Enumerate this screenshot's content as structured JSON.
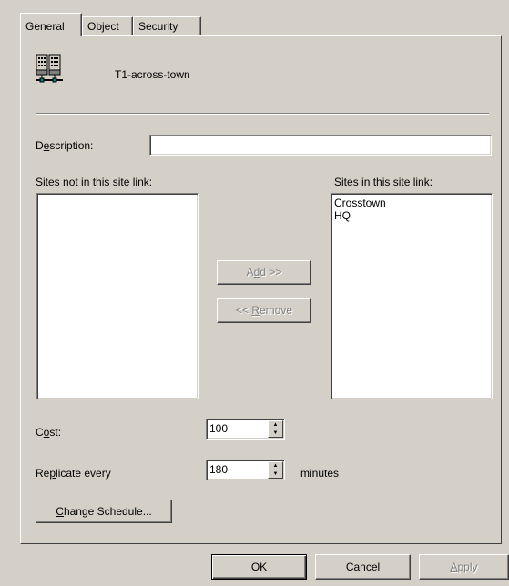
{
  "tabs": [
    {
      "label": "General",
      "active": true
    },
    {
      "label": "Object",
      "active": false
    },
    {
      "label": "Security",
      "active": false
    }
  ],
  "object_icon": "server-icon",
  "object_name": "T1-across-town",
  "description": {
    "label_pre": "D",
    "label_u": "e",
    "label_post": "scription:",
    "value": ""
  },
  "sites_not_in": {
    "label_pre": "Sites ",
    "label_u": "n",
    "label_post": "ot in this site link:",
    "items": []
  },
  "sites_in": {
    "label_pre": "",
    "label_u": "S",
    "label_post": "ites in this site link:",
    "items": [
      "Crosstown",
      "HQ"
    ]
  },
  "add_button": {
    "pre": "A",
    "u": "d",
    "post": "d >>"
  },
  "remove_button": {
    "pre": "<< ",
    "u": "R",
    "post": "emove"
  },
  "cost": {
    "label_pre": "C",
    "label_u": "o",
    "label_post": "st:",
    "value": "100"
  },
  "replicate": {
    "label_pre": "Re",
    "label_u": "p",
    "label_post": "licate every",
    "value": "180",
    "unit": "minutes"
  },
  "change_schedule": {
    "pre": "",
    "u": "C",
    "post": "hange Schedule..."
  },
  "footer": {
    "ok": "OK",
    "cancel": "Cancel",
    "apply_u": "A",
    "apply_post": "pply"
  }
}
